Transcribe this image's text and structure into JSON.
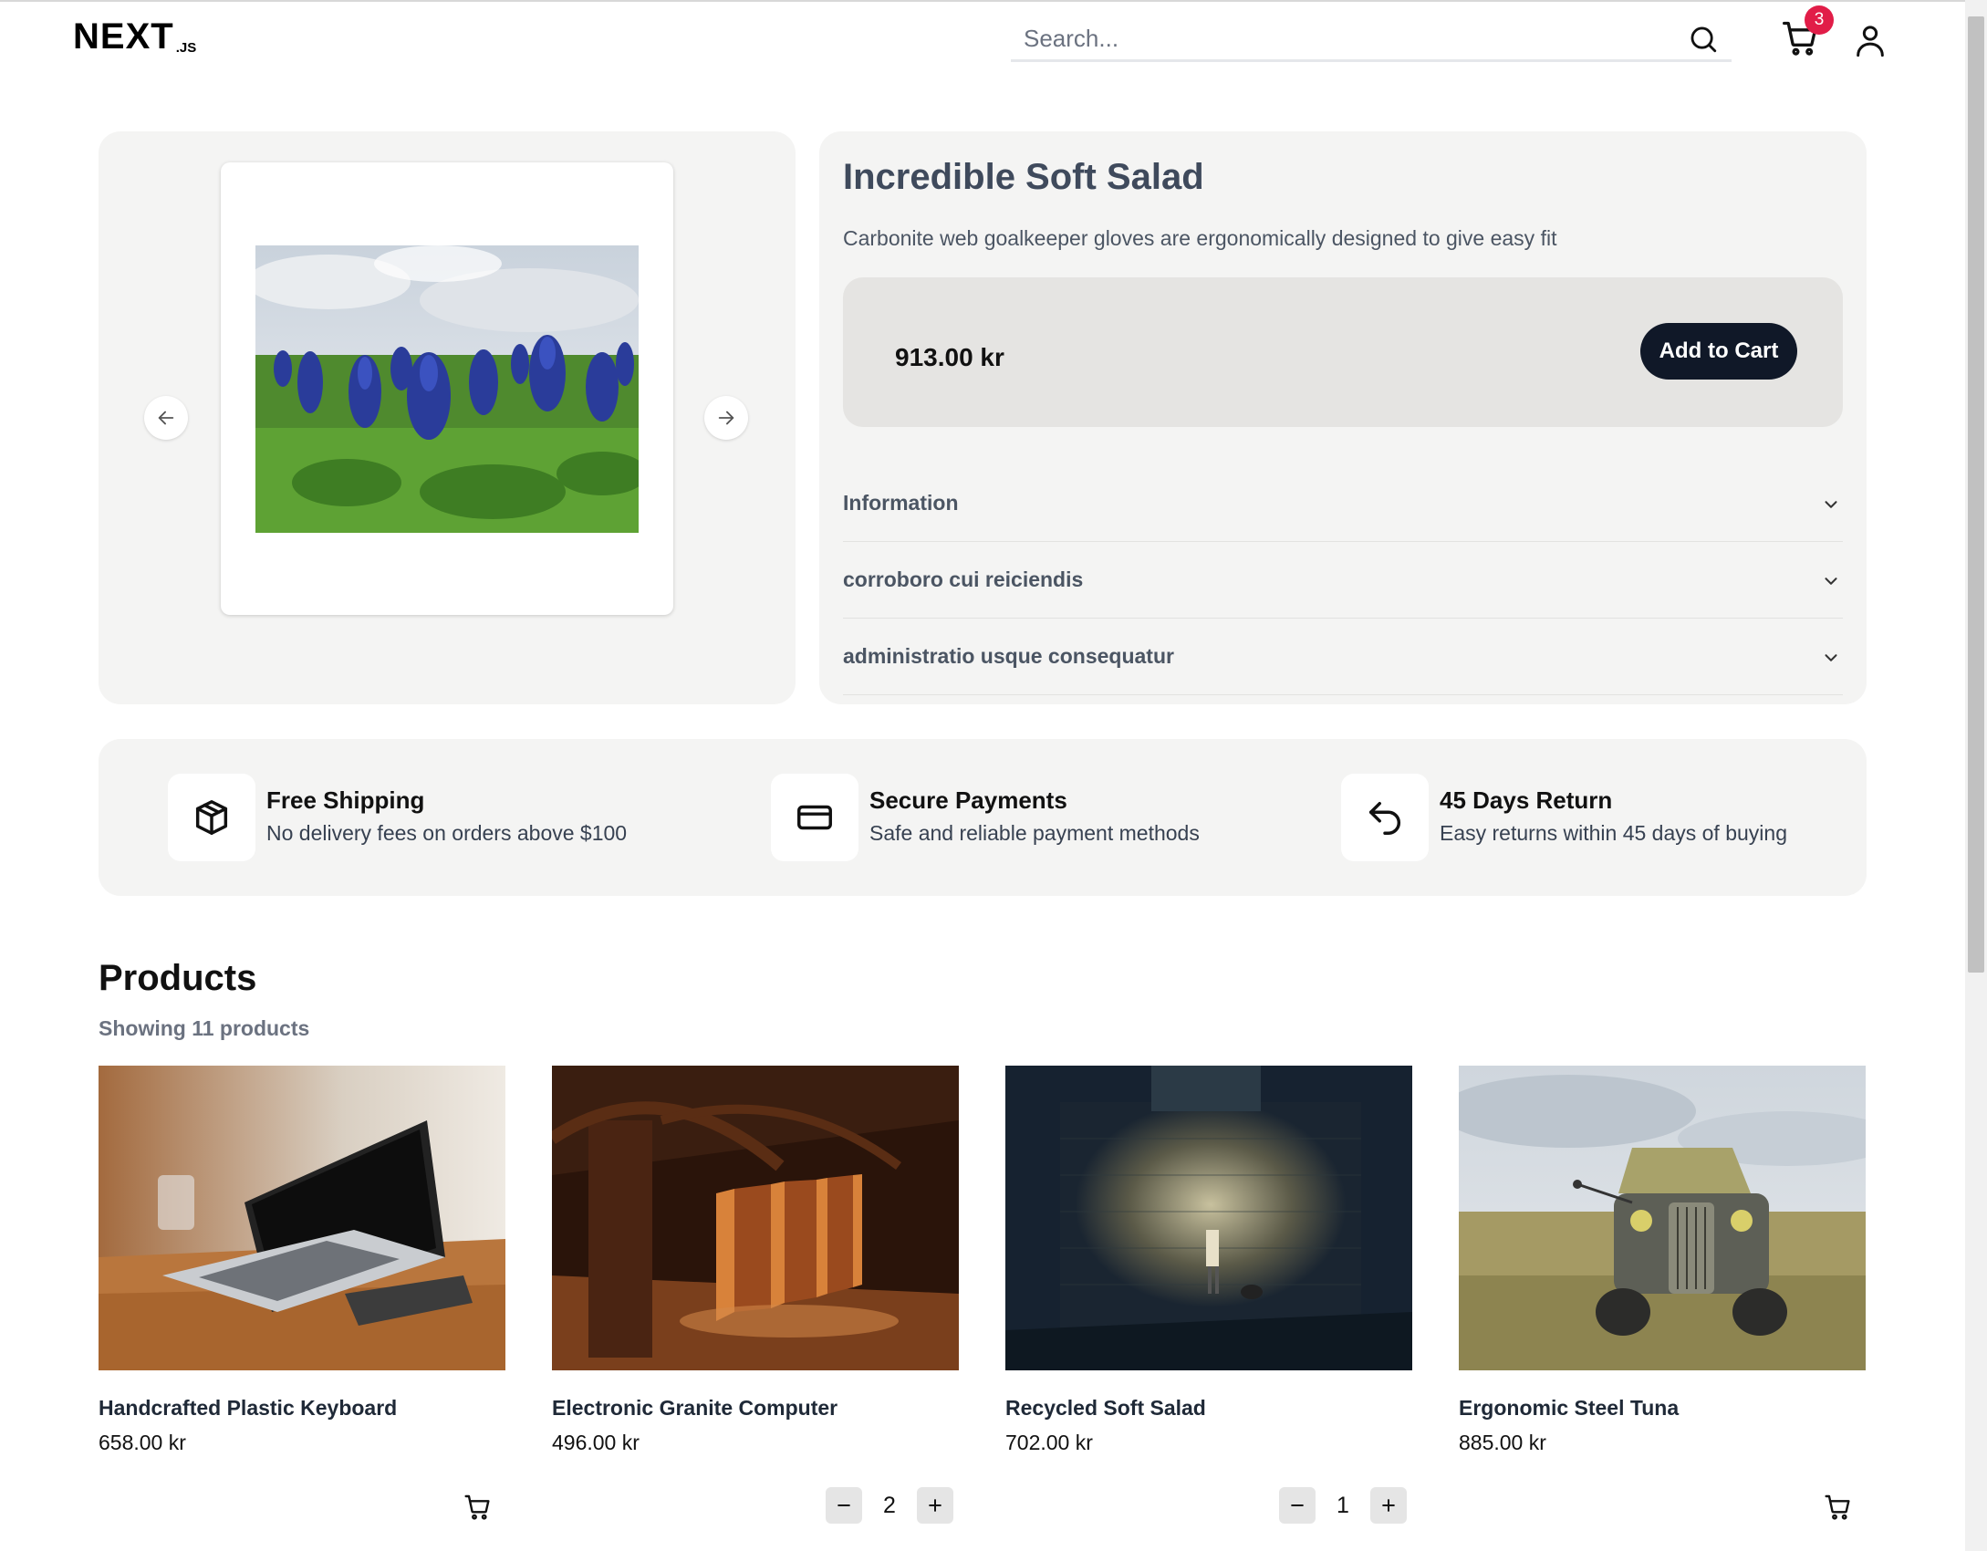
{
  "header": {
    "logo_main": "NEXT",
    "logo_suffix": ".JS",
    "search_placeholder": "Search...",
    "cart_count": "3"
  },
  "product": {
    "title": "Incredible Soft Salad",
    "description": "Carbonite web goalkeeper gloves are ergonomically designed to give easy fit",
    "price": "913.00 kr",
    "add_to_cart_label": "Add to Cart",
    "accordions": [
      {
        "label": "Information"
      },
      {
        "label": "corroboro cui reiciendis"
      },
      {
        "label": "administratio usque consequatur"
      }
    ]
  },
  "features": [
    {
      "title": "Free Shipping",
      "description": "No delivery fees on orders above $100",
      "icon": "box-icon"
    },
    {
      "title": "Secure Payments",
      "description": "Safe and reliable payment methods",
      "icon": "credit-card-icon"
    },
    {
      "title": "45 Days Return",
      "description": "Easy returns within 45 days of buying",
      "icon": "return-arrow-icon"
    }
  ],
  "products_section": {
    "title": "Products",
    "count_text": "Showing 11 products"
  },
  "products": [
    {
      "name": "Handcrafted Plastic Keyboard",
      "price": "658.00 kr",
      "quantity": null
    },
    {
      "name": "Electronic Granite Computer",
      "price": "496.00 kr",
      "quantity": "2"
    },
    {
      "name": "Recycled Soft Salad",
      "price": "702.00 kr",
      "quantity": "1"
    },
    {
      "name": "Ergonomic Steel Tuna",
      "price": "885.00 kr",
      "quantity": null
    }
  ],
  "colors": {
    "accent_dark": "#101828",
    "badge": "#e11d48",
    "panel_bg": "#f4f4f3",
    "price_box_bg": "#e5e4e2"
  }
}
